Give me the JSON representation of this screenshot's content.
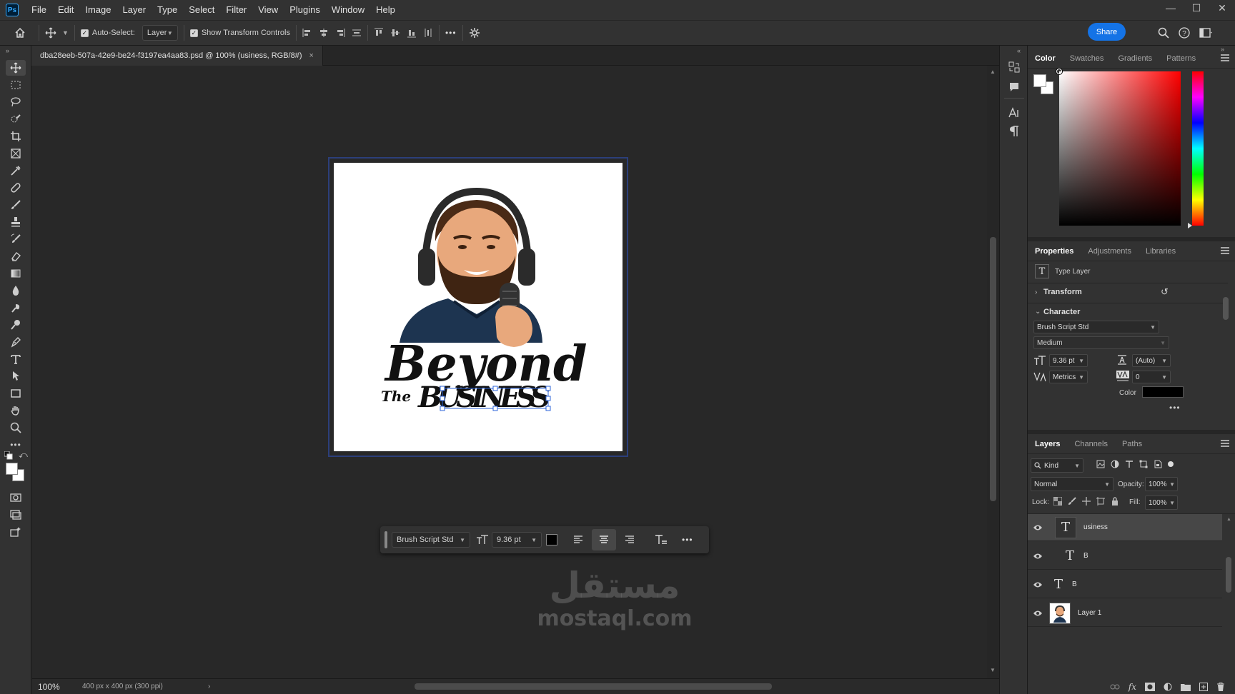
{
  "app": {
    "logo": "Ps"
  },
  "menu": [
    "File",
    "Edit",
    "Image",
    "Layer",
    "Type",
    "Select",
    "Filter",
    "View",
    "Plugins",
    "Window",
    "Help"
  ],
  "window_controls": {
    "minimize": "—",
    "maximize": "☐",
    "close": "✕"
  },
  "options_bar": {
    "auto_select_label": "Auto-Select:",
    "auto_select_checked": true,
    "auto_select_target": "Layer",
    "show_transform_label": "Show Transform Controls",
    "show_transform_checked": true,
    "more": "•••",
    "share_label": "Share"
  },
  "document": {
    "tab_title": "dba28eeb-507a-42e9-be24-f3197ea4aa83.psd @ 100% (usiness, RGB/8#)",
    "close": "×",
    "zoom": "100%",
    "size_info": "400 px x 400 px (300 ppi)"
  },
  "artwork": {
    "line1": "Beyond",
    "line2_small": "The",
    "line2_big": "BUSINESS"
  },
  "context_bar": {
    "font": "Brush Script Std",
    "size": "9.36 pt",
    "color": "#000000",
    "more": "•••"
  },
  "color_panel": {
    "tabs": [
      "Color",
      "Swatches",
      "Gradients",
      "Patterns"
    ],
    "active_tab": "Color",
    "foreground": "#ffffff",
    "background": "#ffffff"
  },
  "properties_panel": {
    "tabs": [
      "Properties",
      "Adjustments",
      "Libraries"
    ],
    "active_tab": "Properties",
    "layer_type": "Type Layer",
    "transform_label": "Transform",
    "character_label": "Character",
    "font_family": "Brush Script Std",
    "font_style": "Medium",
    "font_size": "9.36 pt",
    "leading": "(Auto)",
    "kerning": "Metrics",
    "tracking": "0",
    "color_label": "Color",
    "color_value": "#000000",
    "more": "•••"
  },
  "layers_panel": {
    "tabs": [
      "Layers",
      "Channels",
      "Paths"
    ],
    "active_tab": "Layers",
    "filter_kind": "Kind",
    "blend_mode": "Normal",
    "opacity_label": "Opacity:",
    "opacity": "100%",
    "lock_label": "Lock:",
    "fill_label": "Fill:",
    "fill": "100%",
    "layers": [
      {
        "name": "usiness",
        "type": "text",
        "selected": true
      },
      {
        "name": "B",
        "type": "text",
        "selected": false
      },
      {
        "name": "B",
        "type": "text",
        "selected": false
      },
      {
        "name": "Layer 1",
        "type": "image",
        "selected": false
      }
    ],
    "text_thumb_glyph": "T",
    "footer_fx": "fx"
  },
  "watermark": {
    "arabic": "مستقل",
    "latin": "mostaql.com"
  }
}
